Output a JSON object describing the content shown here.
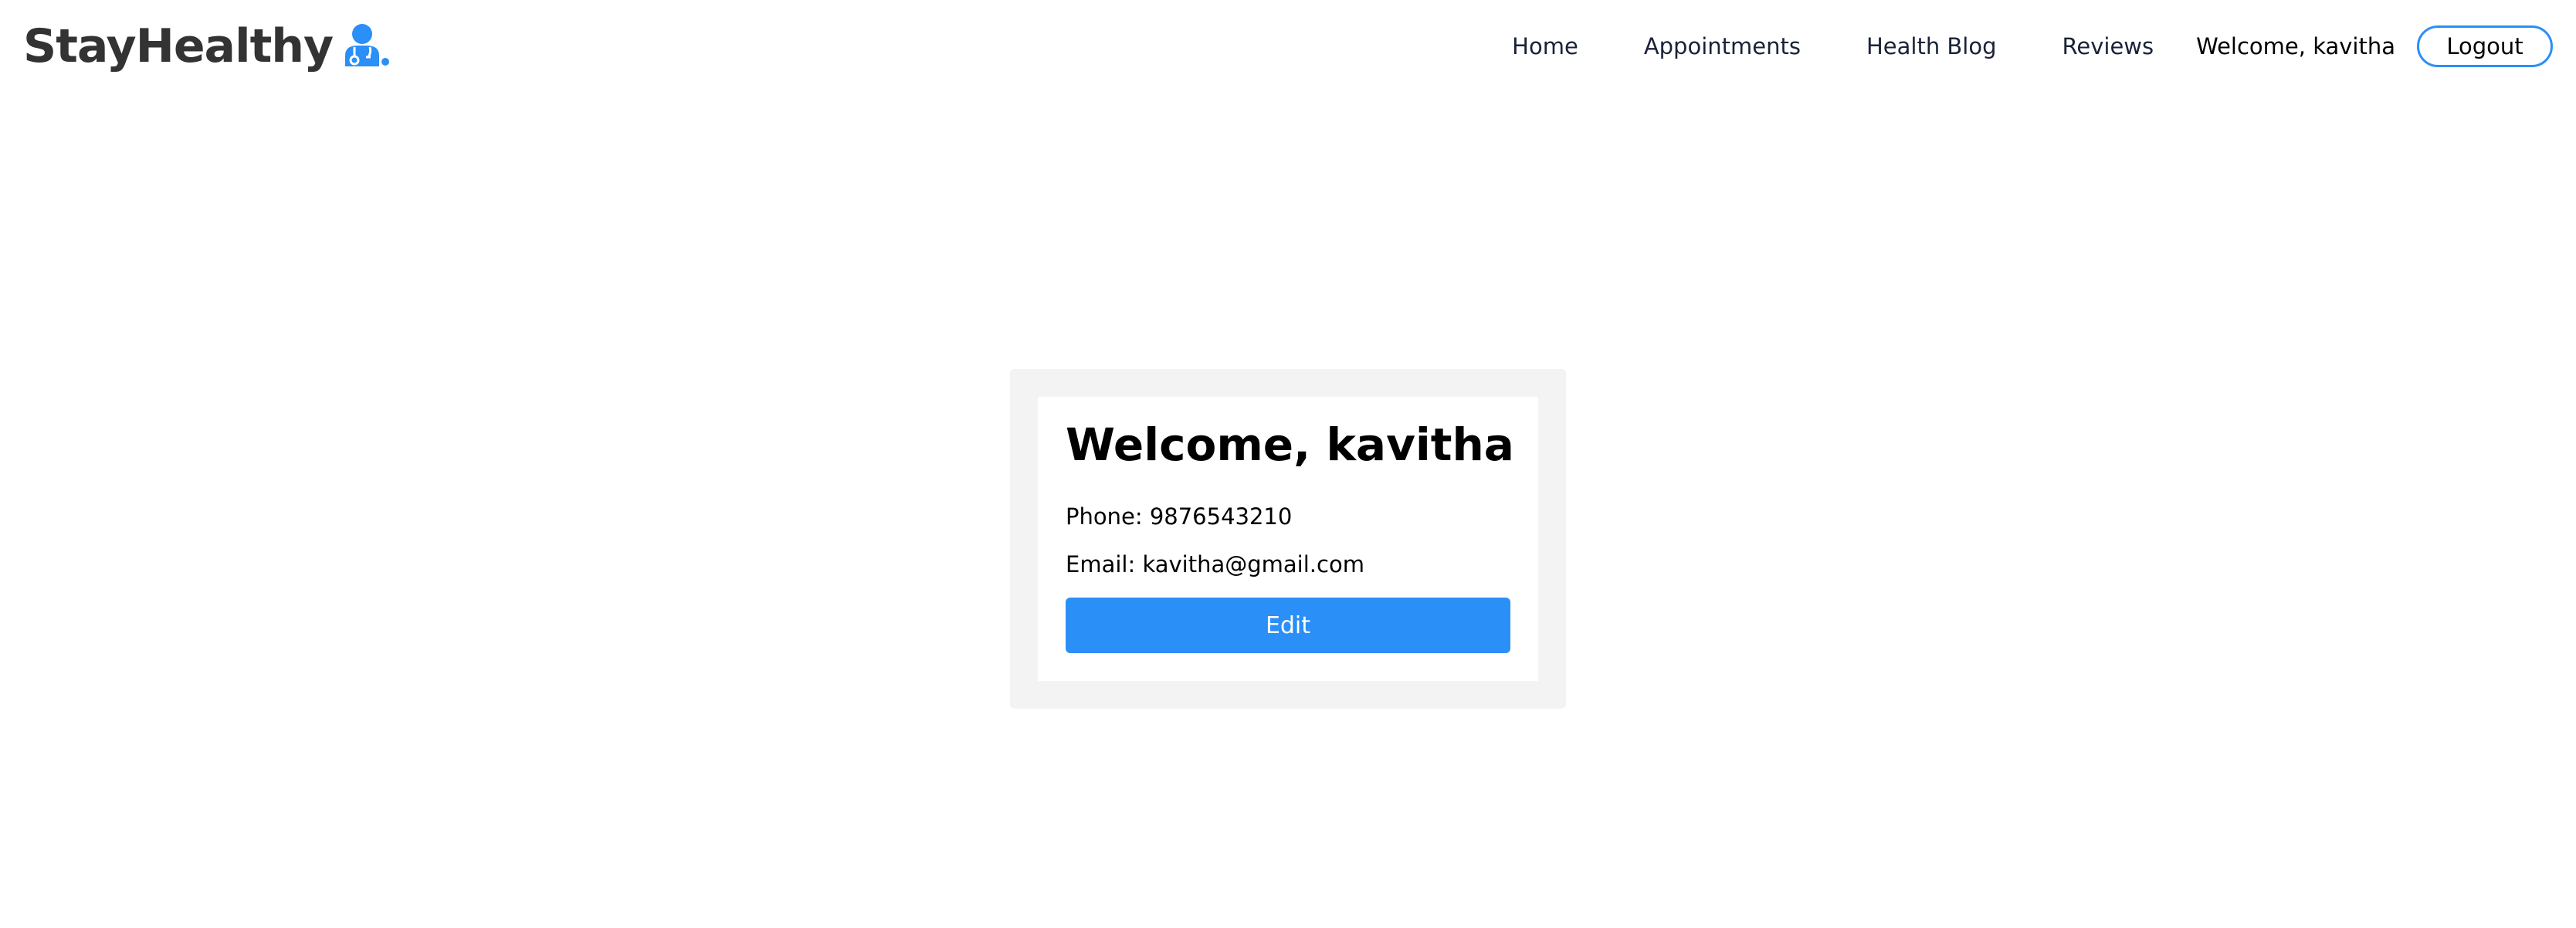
{
  "brand": {
    "name": "StayHealthy",
    "icon": "doctor-icon",
    "accent_color": "#2a8ff7"
  },
  "nav": {
    "home_label": "Home",
    "appointments_label": "Appointments",
    "blog_label": "Health Blog",
    "reviews_label": "Reviews",
    "welcome_text": "Welcome, kavitha",
    "logout_label": "Logout"
  },
  "profile": {
    "title": "Welcome, kavitha",
    "phone": "Phone: 9876543210",
    "email": "Email: kavitha@gmail.com",
    "edit_label": "Edit"
  },
  "colors": {
    "primary": "#2a8ff7",
    "card_background": "#f3f3f3",
    "text": "#000000",
    "brand_text": "#333333"
  }
}
